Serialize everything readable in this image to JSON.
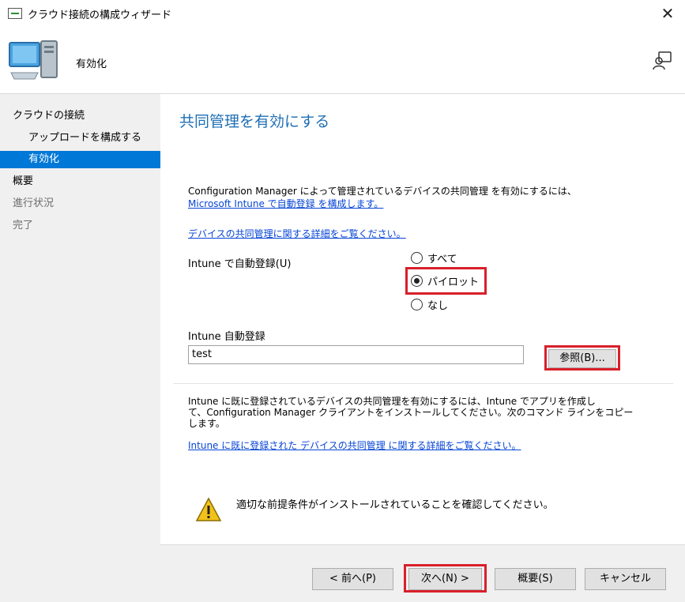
{
  "window": {
    "title": "クラウド接続の構成ウィザード"
  },
  "header": {
    "step_title": "有効化"
  },
  "sidebar": {
    "items": [
      {
        "label": "クラウドの接続"
      },
      {
        "label": "アップロードを構成する"
      },
      {
        "label": "有効化"
      },
      {
        "label": "概要"
      },
      {
        "label": "進行状況"
      },
      {
        "label": "完了"
      }
    ]
  },
  "main": {
    "page_title": "共同管理を有効にする",
    "intro_text": "Configuration Manager によって管理されているデバイスの共同管理 を有効にするには、",
    "intro_link": "Microsoft Intune で自動登録 を構成します。",
    "details_link": "デバイスの共同管理に関する詳細をご覧ください。",
    "auto_enroll_label": "Intune で自動登録(U)",
    "radio_options": [
      {
        "label": "すべて",
        "checked": false
      },
      {
        "label": "パイロット",
        "checked": true
      },
      {
        "label": "なし",
        "checked": false
      }
    ],
    "collection_label": "Intune 自動登録",
    "collection_value": "test",
    "browse_button": "参照(B)...",
    "existing_text_line1": "Intune に既に登録されているデバイスの共同管理を有効にするには、Intune でアプリを作成し",
    "existing_text_line2": "て、Configuration Manager クライアントをインストールしてください。次のコマンド ラインをコピー",
    "existing_text_line3": "します。",
    "existing_link": "Intune に既に登録された デバイスの共同管理 に関する詳細をご覧ください。",
    "warning_text": "適切な前提条件がインストールされていることを確認してください。"
  },
  "footer": {
    "back_button": "< 前へ(P)",
    "next_button": "次へ(N) >",
    "summary_button": "概要(S)",
    "cancel_button": "キャンセル"
  },
  "colors": {
    "accent": "#0078d7",
    "title_blue": "#1f6fb5",
    "link": "#0645d6",
    "highlight_red": "#d8202a"
  },
  "icons": [
    "wizard-app-icon",
    "close-icon",
    "computer-icon",
    "help-feedback-icon",
    "warning-icon"
  ]
}
